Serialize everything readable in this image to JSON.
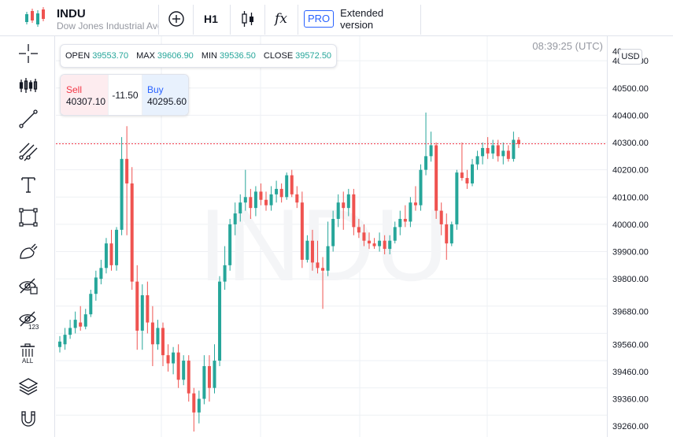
{
  "header": {
    "symbol": "INDU",
    "description": "Dow Jones Industrial Average",
    "interval": "H1",
    "indicators_glyph": "fx",
    "pro_badge": "PRO",
    "pro_label": "Extended version"
  },
  "sidebar": {
    "tools": [
      "crosshair-icon",
      "indicator-bars-icon",
      "trend-line-icon",
      "fib-channel-icon",
      "text-icon",
      "rectangle-icon",
      "brush-icon",
      "hide-drawings-icon",
      "hide-indicators-icon",
      "delete-all-icon",
      "layers-icon",
      "magnet-icon"
    ],
    "delete_all_label": "ALL",
    "hide_indicators_label": "123"
  },
  "legend": {
    "open_label": "OPEN",
    "open": "39553.70",
    "high_label": "MAX",
    "high": "39606.90",
    "low_label": "MIN",
    "low": "39536.50",
    "close_label": "CLOSE",
    "close": "39572.50"
  },
  "trade": {
    "sell_label": "Sell",
    "sell_price": "40307.10",
    "spread": "-11.50",
    "buy_label": "Buy",
    "buy_price": "40295.60"
  },
  "clock": "08:39:25 (UTC)",
  "currency": "USD",
  "watermark": "INDU",
  "colors": {
    "up": "#26a69a",
    "down": "#ef5350",
    "price_line": "#f23645",
    "grid": "#eef0f4",
    "accent": "#2962ff"
  },
  "price_axis": {
    "labels": [
      "40600.00",
      "40500.00",
      "40400.00",
      "40300.00",
      "40200.00",
      "40100.00",
      "40000.00",
      "39900.00",
      "39800.00",
      "39680.00",
      "39560.00",
      "39460.00",
      "39360.00",
      "39260.00"
    ],
    "top_partial": "40"
  },
  "chart_data": {
    "type": "candlestick",
    "symbol": "INDU",
    "timeframe": "H1",
    "current_price_line": 40295.6,
    "y_range": [
      39220,
      40690
    ],
    "candles": [
      {
        "o": 39550,
        "h": 39590,
        "l": 39530,
        "c": 39570
      },
      {
        "o": 39560,
        "h": 39620,
        "l": 39540,
        "c": 39595
      },
      {
        "o": 39595,
        "h": 39650,
        "l": 39580,
        "c": 39620
      },
      {
        "o": 39620,
        "h": 39680,
        "l": 39600,
        "c": 39650
      },
      {
        "o": 39640,
        "h": 39700,
        "l": 39610,
        "c": 39625
      },
      {
        "o": 39625,
        "h": 39690,
        "l": 39615,
        "c": 39670
      },
      {
        "o": 39670,
        "h": 39760,
        "l": 39660,
        "c": 39745
      },
      {
        "o": 39745,
        "h": 39830,
        "l": 39720,
        "c": 39805
      },
      {
        "o": 39800,
        "h": 39870,
        "l": 39780,
        "c": 39840
      },
      {
        "o": 39840,
        "h": 39950,
        "l": 39820,
        "c": 39930
      },
      {
        "o": 39930,
        "h": 39980,
        "l": 39830,
        "c": 39850
      },
      {
        "o": 39850,
        "h": 39990,
        "l": 39830,
        "c": 39980
      },
      {
        "o": 39980,
        "h": 40320,
        "l": 39960,
        "c": 40240
      },
      {
        "o": 40240,
        "h": 40360,
        "l": 39960,
        "c": 40150
      },
      {
        "o": 40150,
        "h": 40210,
        "l": 39760,
        "c": 39790
      },
      {
        "o": 39790,
        "h": 39850,
        "l": 39540,
        "c": 39610
      },
      {
        "o": 39610,
        "h": 39780,
        "l": 39540,
        "c": 39740
      },
      {
        "o": 39740,
        "h": 39790,
        "l": 39600,
        "c": 39640
      },
      {
        "o": 39640,
        "h": 39700,
        "l": 39480,
        "c": 39560
      },
      {
        "o": 39560,
        "h": 39650,
        "l": 39540,
        "c": 39620
      },
      {
        "o": 39620,
        "h": 39640,
        "l": 39480,
        "c": 39520
      },
      {
        "o": 39520,
        "h": 39560,
        "l": 39460,
        "c": 39490
      },
      {
        "o": 39490,
        "h": 39550,
        "l": 39450,
        "c": 39530
      },
      {
        "o": 39530,
        "h": 39560,
        "l": 39400,
        "c": 39430
      },
      {
        "o": 39430,
        "h": 39520,
        "l": 39410,
        "c": 39500
      },
      {
        "o": 39500,
        "h": 39520,
        "l": 39350,
        "c": 39380
      },
      {
        "o": 39380,
        "h": 39400,
        "l": 39240,
        "c": 39310
      },
      {
        "o": 39310,
        "h": 39390,
        "l": 39270,
        "c": 39360
      },
      {
        "o": 39360,
        "h": 39520,
        "l": 39340,
        "c": 39480
      },
      {
        "o": 39480,
        "h": 39520,
        "l": 39350,
        "c": 39400
      },
      {
        "o": 39400,
        "h": 39560,
        "l": 39380,
        "c": 39500
      },
      {
        "o": 39500,
        "h": 39810,
        "l": 39480,
        "c": 39790
      },
      {
        "o": 39790,
        "h": 39920,
        "l": 39760,
        "c": 39850
      },
      {
        "o": 39850,
        "h": 40020,
        "l": 39830,
        "c": 40000
      },
      {
        "o": 40000,
        "h": 40080,
        "l": 39960,
        "c": 40040
      },
      {
        "o": 40040,
        "h": 40110,
        "l": 40010,
        "c": 40080
      },
      {
        "o": 40080,
        "h": 40200,
        "l": 40050,
        "c": 40100
      },
      {
        "o": 40100,
        "h": 40130,
        "l": 40020,
        "c": 40060
      },
      {
        "o": 40060,
        "h": 40140,
        "l": 40030,
        "c": 40120
      },
      {
        "o": 40120,
        "h": 40150,
        "l": 40070,
        "c": 40090
      },
      {
        "o": 40090,
        "h": 40120,
        "l": 40050,
        "c": 40070
      },
      {
        "o": 40070,
        "h": 40140,
        "l": 40050,
        "c": 40110
      },
      {
        "o": 40110,
        "h": 40160,
        "l": 40080,
        "c": 40130
      },
      {
        "o": 40130,
        "h": 40150,
        "l": 40080,
        "c": 40100
      },
      {
        "o": 40100,
        "h": 40190,
        "l": 40090,
        "c": 40180
      },
      {
        "o": 40180,
        "h": 40200,
        "l": 40100,
        "c": 40110
      },
      {
        "o": 40110,
        "h": 40140,
        "l": 40060,
        "c": 40080
      },
      {
        "o": 40080,
        "h": 40120,
        "l": 39840,
        "c": 39870
      },
      {
        "o": 39870,
        "h": 39960,
        "l": 39860,
        "c": 39940
      },
      {
        "o": 39940,
        "h": 39980,
        "l": 39830,
        "c": 39860
      },
      {
        "o": 39860,
        "h": 39940,
        "l": 39820,
        "c": 39840
      },
      {
        "o": 39840,
        "h": 39880,
        "l": 39690,
        "c": 39830
      },
      {
        "o": 39830,
        "h": 40010,
        "l": 39810,
        "c": 39920
      },
      {
        "o": 39920,
        "h": 40050,
        "l": 39900,
        "c": 40020
      },
      {
        "o": 40020,
        "h": 40110,
        "l": 39990,
        "c": 40080
      },
      {
        "o": 40080,
        "h": 40120,
        "l": 39980,
        "c": 40060
      },
      {
        "o": 40060,
        "h": 40130,
        "l": 40030,
        "c": 40110
      },
      {
        "o": 40110,
        "h": 40130,
        "l": 39960,
        "c": 39990
      },
      {
        "o": 39990,
        "h": 40020,
        "l": 39950,
        "c": 39970
      },
      {
        "o": 39970,
        "h": 40000,
        "l": 39920,
        "c": 39940
      },
      {
        "o": 39940,
        "h": 39970,
        "l": 39910,
        "c": 39930
      },
      {
        "o": 39930,
        "h": 39950,
        "l": 39910,
        "c": 39920
      },
      {
        "o": 39920,
        "h": 39970,
        "l": 39900,
        "c": 39940
      },
      {
        "o": 39940,
        "h": 39960,
        "l": 39890,
        "c": 39910
      },
      {
        "o": 39910,
        "h": 39960,
        "l": 39890,
        "c": 39940
      },
      {
        "o": 39940,
        "h": 40010,
        "l": 39930,
        "c": 39990
      },
      {
        "o": 39990,
        "h": 40050,
        "l": 39960,
        "c": 40020
      },
      {
        "o": 40020,
        "h": 40070,
        "l": 39990,
        "c": 40010
      },
      {
        "o": 40010,
        "h": 40100,
        "l": 39990,
        "c": 40080
      },
      {
        "o": 40080,
        "h": 40140,
        "l": 40050,
        "c": 40070
      },
      {
        "o": 40070,
        "h": 40220,
        "l": 40050,
        "c": 40200
      },
      {
        "o": 40200,
        "h": 40410,
        "l": 40180,
        "c": 40250
      },
      {
        "o": 40250,
        "h": 40340,
        "l": 40230,
        "c": 40290
      },
      {
        "o": 40290,
        "h": 40300,
        "l": 40020,
        "c": 40050
      },
      {
        "o": 40050,
        "h": 40080,
        "l": 39960,
        "c": 40000
      },
      {
        "o": 40000,
        "h": 40040,
        "l": 39870,
        "c": 39930
      },
      {
        "o": 39930,
        "h": 40010,
        "l": 39920,
        "c": 40000
      },
      {
        "o": 40000,
        "h": 40200,
        "l": 39980,
        "c": 40190
      },
      {
        "o": 40190,
        "h": 40300,
        "l": 40160,
        "c": 40170
      },
      {
        "o": 40170,
        "h": 40200,
        "l": 40130,
        "c": 40150
      },
      {
        "o": 40150,
        "h": 40240,
        "l": 40140,
        "c": 40220
      },
      {
        "o": 40220,
        "h": 40270,
        "l": 40200,
        "c": 40250
      },
      {
        "o": 40250,
        "h": 40300,
        "l": 40220,
        "c": 40280
      },
      {
        "o": 40280,
        "h": 40320,
        "l": 40240,
        "c": 40260
      },
      {
        "o": 40260,
        "h": 40310,
        "l": 40240,
        "c": 40290
      },
      {
        "o": 40290,
        "h": 40310,
        "l": 40230,
        "c": 40250
      },
      {
        "o": 40250,
        "h": 40300,
        "l": 40220,
        "c": 40270
      },
      {
        "o": 40270,
        "h": 40290,
        "l": 40230,
        "c": 40240
      },
      {
        "o": 40240,
        "h": 40340,
        "l": 40230,
        "c": 40310
      },
      {
        "o": 40310,
        "h": 40320,
        "l": 40280,
        "c": 40295
      }
    ]
  }
}
